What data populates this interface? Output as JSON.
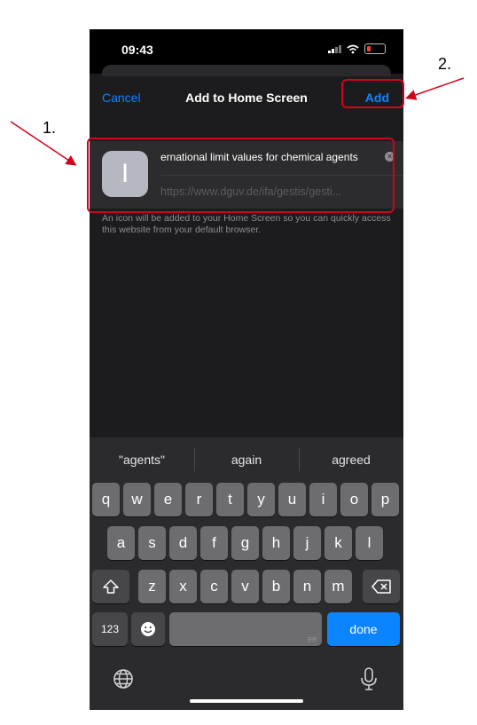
{
  "annotations": {
    "step1": "1.",
    "step2": "2.",
    "highlight_color": "#d0021b"
  },
  "status": {
    "time": "09:43"
  },
  "nav": {
    "cancel": "Cancel",
    "title": "Add to Home Screen",
    "add": "Add"
  },
  "card": {
    "icon_letter": "I",
    "name_value": "ernational limit values for chemical agents",
    "url": "https://www.dguv.de/ifa/gestis/gesti..."
  },
  "description": "An icon will be added to your Home Screen so you can quickly access this website from your default browser.",
  "keyboard": {
    "suggestions": [
      "\"agents\"",
      "again",
      "agreed"
    ],
    "row1": [
      "q",
      "w",
      "e",
      "r",
      "t",
      "y",
      "u",
      "i",
      "o",
      "p"
    ],
    "row2": [
      "a",
      "s",
      "d",
      "f",
      "g",
      "h",
      "j",
      "k",
      "l"
    ],
    "row3": [
      "z",
      "x",
      "c",
      "v",
      "b",
      "n",
      "m"
    ],
    "numbers_key": "123",
    "space_hint": "ЕЯ",
    "done_key": "done"
  },
  "colors": {
    "accent": "#0a84ff",
    "background": "#1c1c1e"
  }
}
